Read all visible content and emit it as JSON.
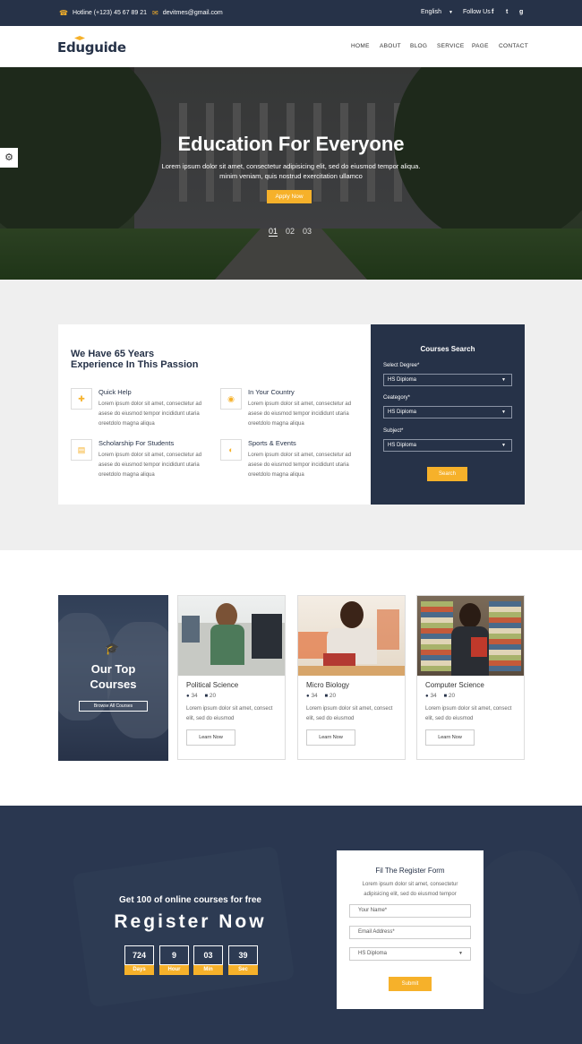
{
  "topbar": {
    "hotline": "Hotline (+123) 45 67 89 21",
    "email": "devitmes@gmail.com",
    "language": "English",
    "follow_label": "Follow Us :",
    "social": [
      "f",
      "t",
      "g"
    ]
  },
  "header": {
    "logo": "Eduguide",
    "nav": [
      "HOME",
      "ABOUT",
      "BLOG",
      "SERVICE",
      "PAGE",
      "CONTACT"
    ]
  },
  "hero": {
    "title": "Education For Everyone",
    "subtitle": "Lorem ipsum dolor sit amet, consectetur adipisicing elit, sed do eiusmod tempor aliqua. minim veniam, quis nostrud exercitation ullamco",
    "button": "Apply Now",
    "slides": [
      "01",
      "02",
      "03"
    ],
    "active_slide": "01"
  },
  "about": {
    "heading": "We Have 65 Years Experience In This Passion",
    "features": [
      {
        "title": "Quick Help",
        "text": "Lorem ipsum dolor sit amet, consectetur ad asese do eiusmod tempor incididunt utaria oreetdolo magna aliqua",
        "icon": "help-icon"
      },
      {
        "title": "In Your Country",
        "text": "Lorem ipsum dolor sit amet, consectetur ad asese do eiusmod tempor incididunt utaria oreetdolo magna aliqua",
        "icon": "globe-icon"
      },
      {
        "title": "Scholarship For Students",
        "text": "Lorem ipsum dolor sit amet, consectetur ad asese do eiusmod tempor incididunt utaria oreetdolo magna aliqua",
        "icon": "scholarship-icon"
      },
      {
        "title": "Sports & Events",
        "text": "Lorem ipsum dolor sit amet, consectetur ad asese do eiusmod tempor incididunt utaria oreetdolo magna aliqua",
        "icon": "sports-icon"
      }
    ]
  },
  "course_search": {
    "title": "Courses Search",
    "fields": [
      {
        "label": "Select Degree*",
        "value": "HS Diploma"
      },
      {
        "label": "Ceategory*",
        "value": "HS Diploma"
      },
      {
        "label": "Subject*",
        "value": "HS Diploma"
      }
    ],
    "button": "Search"
  },
  "courses": {
    "feature_title_line1": "Our Top",
    "feature_title_line2": "Courses",
    "browse_button": "Browse All Courses",
    "items": [
      {
        "title": "Political Science",
        "views": "34",
        "comments": "20",
        "text": "Lorem ipsum dolor sit amet, consect elit, sed do eiusmod",
        "button": "Learn Now"
      },
      {
        "title": "Micro Biology",
        "views": "34",
        "comments": "20",
        "text": "Lorem ipsum dolor sit amet, consect elit, sed do eiusmod",
        "button": "Learn Now"
      },
      {
        "title": "Computer Science",
        "views": "34",
        "comments": "20",
        "text": "Lorem ipsum dolor sit amet, consect elit, sed do eiusmod",
        "button": "Learn Now"
      }
    ]
  },
  "register": {
    "subtitle": "Get 100 of online courses for free",
    "title": "Register Now",
    "countdown": [
      {
        "value": "724",
        "unit": "Days"
      },
      {
        "value": "9",
        "unit": "Hour"
      },
      {
        "value": "03",
        "unit": "Min"
      },
      {
        "value": "39",
        "unit": "Sec"
      }
    ],
    "form": {
      "title": "Fil The Register Form",
      "text": "Lorem ipsum dolor sit amet, consectetur adipisicing elit, sed do eiusmod tempor",
      "name_placeholder": "Your Name*",
      "email_placeholder": "Email Address*",
      "select_value": "HS Diploma",
      "button": "Submit"
    }
  },
  "colors": {
    "accent": "#f6b12a",
    "navy": "#263248"
  }
}
